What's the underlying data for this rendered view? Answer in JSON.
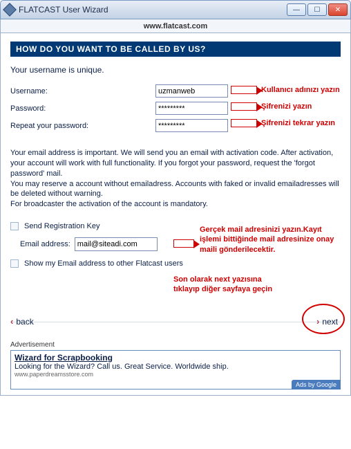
{
  "window": {
    "title": "FLATCAST User Wizard",
    "url": "www.flatcast.com"
  },
  "header": "HOW DO YOU WANT TO BE CALLED BY US?",
  "subtitle": "Your username is unique.",
  "form": {
    "username_label": "Username:",
    "username_value": "uzmanweb",
    "password_label": "Password:",
    "password_value": "*********",
    "repeat_label": "Repeat your password:",
    "repeat_value": "*********"
  },
  "annotations": {
    "username": "Kullanıcı adınızı yazın",
    "password": "Şifrenizi yazın",
    "repeat": "Şifrenizi tekrar yazın",
    "email": "Gerçek mail adresinizi yazın.Kayıt işlemi bittiğinde mail adresinize onay maili gönderilecektir.",
    "next": "Son olarak next yazısına tıklayıp diğer sayfaya geçin"
  },
  "paragraph": "Your email address is important. We will send you an email with activation code. After activation, your account will work with full functionality. If you forgot your password, request the 'forgot password' mail.\nYou may reserve a account without emailadress. Accounts with faked or invalid emailadresses will be deleted without warning.\nFor broadcaster the activation of the account is mandatory.",
  "check_reg_key": "Send Registration Key",
  "email_label": "Email address:",
  "email_value": "mail@siteadi.com",
  "check_show_email": "Show my Email address to other Flatcast users",
  "nav": {
    "back": "back",
    "next": "next"
  },
  "ad": {
    "section": "Advertisement",
    "title": "Wizard for Scrapbooking",
    "text": "Looking for the Wizard? Call us. Great Service. Worldwide ship.",
    "url": "www.paperdreamsstore.com",
    "badge": "Ads by Google"
  }
}
